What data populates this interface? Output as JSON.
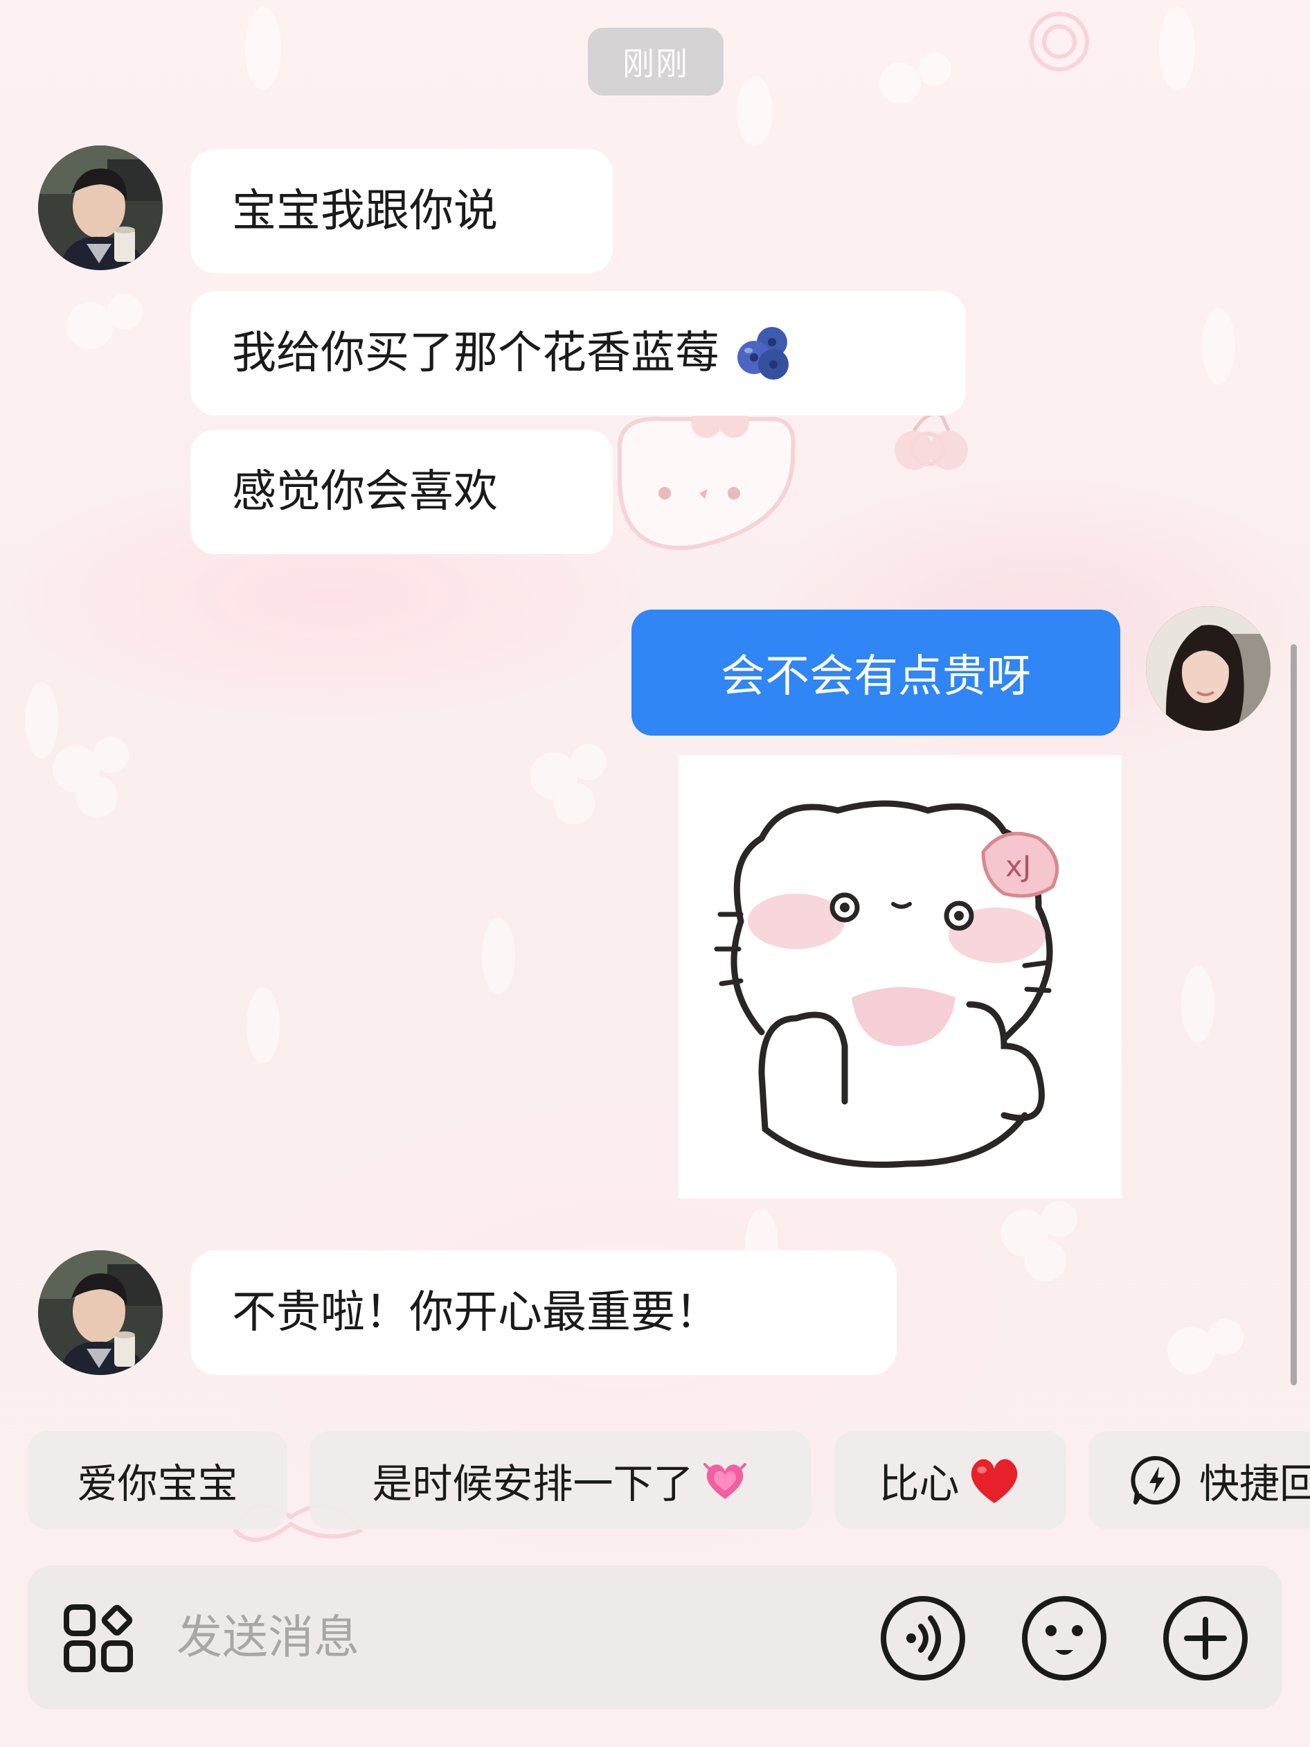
{
  "chat": {
    "timestamp": "刚刚",
    "messages": [
      {
        "sender": "other",
        "text": "宝宝我跟你说"
      },
      {
        "sender": "other",
        "text": "我给你买了那个花香蓝莓"
      },
      {
        "sender": "other",
        "text": "感觉你会喜欢"
      },
      {
        "sender": "self",
        "text": "会不会有点贵呀"
      },
      {
        "sender": "self",
        "type": "sticker",
        "sticker": "cat-sticker"
      },
      {
        "sender": "other",
        "text": "不贵啦！你开心最重要！"
      }
    ]
  },
  "quick_replies": [
    {
      "label": "爱你宝宝"
    },
    {
      "label": "是时候安排一下了",
      "emoji": "growing-heart"
    },
    {
      "label": "比心",
      "emoji": "red-heart"
    },
    {
      "label": "快捷回",
      "icon": "lightning-bubble-icon"
    }
  ],
  "input": {
    "placeholder": "发送消息",
    "icons": [
      "apps-icon",
      "voice-icon",
      "emoji-icon",
      "plus-icon"
    ]
  },
  "colors": {
    "accent_blue": "#2f86f4",
    "bubble_white": "#ffffff",
    "background_pink": "#fbeeee",
    "heart_red": "#e8202a",
    "heart_pink": "#f25fa0"
  }
}
